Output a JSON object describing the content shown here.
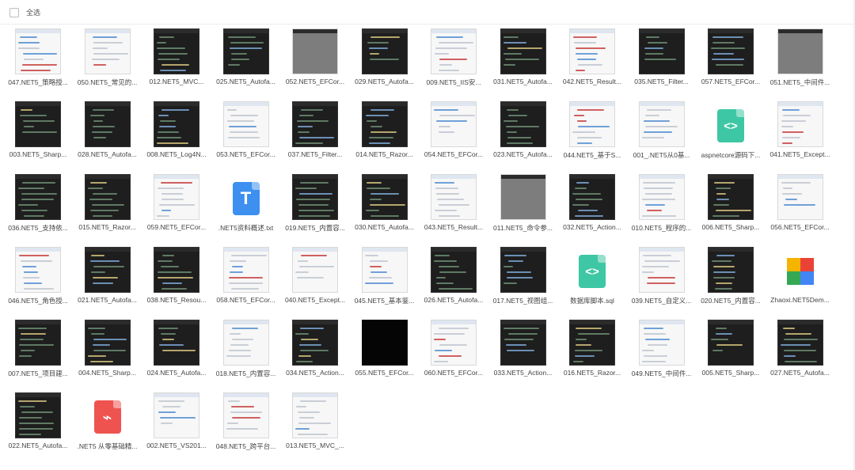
{
  "toolbar": {
    "select_all_label": "全选"
  },
  "files": [
    {
      "name": "047.NET5_策略授...",
      "kind": "image",
      "style": "light"
    },
    {
      "name": "050.NET5_常见的...",
      "kind": "image",
      "style": "light"
    },
    {
      "name": "012.NET5_MVC...",
      "kind": "image",
      "style": "dark"
    },
    {
      "name": "025.NET5_Autofa...",
      "kind": "image",
      "style": "dark"
    },
    {
      "name": "052.NET5_EFCor...",
      "kind": "image",
      "style": "gray"
    },
    {
      "name": "029.NET5_Autofa...",
      "kind": "image",
      "style": "dark"
    },
    {
      "name": "009.NET5_IIS安...",
      "kind": "image",
      "style": "light"
    },
    {
      "name": "031.NET5_Autofa...",
      "kind": "image",
      "style": "dark"
    },
    {
      "name": "042.NET5_Result...",
      "kind": "image",
      "style": "light"
    },
    {
      "name": "035.NET5_Filter...",
      "kind": "image",
      "style": "dark"
    },
    {
      "name": "057.NET5_EFCor...",
      "kind": "image",
      "style": "dark"
    },
    {
      "name": "051.NET5_中间件...",
      "kind": "image",
      "style": "gray"
    },
    {
      "name": "003.NET5_Sharp...",
      "kind": "image",
      "style": "dark"
    },
    {
      "name": "028.NET5_Autofa...",
      "kind": "image",
      "style": "dark"
    },
    {
      "name": "008.NET5_Log4N...",
      "kind": "image",
      "style": "dark"
    },
    {
      "name": "053.NET5_EFCor...",
      "kind": "image",
      "style": "light"
    },
    {
      "name": "037.NET5_Filter...",
      "kind": "image",
      "style": "dark"
    },
    {
      "name": "014.NET5_Razor...",
      "kind": "image",
      "style": "dark"
    },
    {
      "name": "054.NET5_EFCor...",
      "kind": "image",
      "style": "light"
    },
    {
      "name": "023.NET5_Autofa...",
      "kind": "image",
      "style": "dark"
    },
    {
      "name": "044.NET5_基于S...",
      "kind": "image",
      "style": "light"
    },
    {
      "name": "001_.NET5从0基...",
      "kind": "image",
      "style": "light"
    },
    {
      "name": "aspnetcore源码下...",
      "kind": "code"
    },
    {
      "name": "041.NET5_Except...",
      "kind": "image",
      "style": "light"
    },
    {
      "name": "036.NET5_支持依...",
      "kind": "image",
      "style": "dark"
    },
    {
      "name": "015.NET5_Razor...",
      "kind": "image",
      "style": "dark"
    },
    {
      "name": "059.NET5_EFCor...",
      "kind": "image",
      "style": "light"
    },
    {
      "name": ".NET5资料概述.txt",
      "kind": "txt"
    },
    {
      "name": "019.NET5_内置容...",
      "kind": "image",
      "style": "dark"
    },
    {
      "name": "030.NET5_Autofa...",
      "kind": "image",
      "style": "dark"
    },
    {
      "name": "043.NET5_Result...",
      "kind": "image",
      "style": "light"
    },
    {
      "name": "011.NET5_命令参...",
      "kind": "image",
      "style": "gray"
    },
    {
      "name": "032.NET5_Action...",
      "kind": "image",
      "style": "dark"
    },
    {
      "name": "010.NET5_程序的...",
      "kind": "image",
      "style": "light"
    },
    {
      "name": "006.NET5_Sharp...",
      "kind": "image",
      "style": "dark"
    },
    {
      "name": "056.NET5_EFCor...",
      "kind": "image",
      "style": "light"
    },
    {
      "name": "046.NET5_角色授...",
      "kind": "image",
      "style": "light"
    },
    {
      "name": "021.NET5_Autofa...",
      "kind": "image",
      "style": "dark"
    },
    {
      "name": "038.NET5_Resou...",
      "kind": "image",
      "style": "dark"
    },
    {
      "name": "058.NET5_EFCor...",
      "kind": "image",
      "style": "light"
    },
    {
      "name": "040.NET5_Except...",
      "kind": "image",
      "style": "light"
    },
    {
      "name": "045.NET5_基本鉴...",
      "kind": "image",
      "style": "light"
    },
    {
      "name": "026.NET5_Autofa...",
      "kind": "image",
      "style": "dark"
    },
    {
      "name": "017.NET5_视图组...",
      "kind": "image",
      "style": "dark"
    },
    {
      "name": "数据库脚本.sql",
      "kind": "code"
    },
    {
      "name": "039.NET5_自定义...",
      "kind": "image",
      "style": "light"
    },
    {
      "name": "020.NET5_内置容...",
      "kind": "image",
      "style": "dark"
    },
    {
      "name": "Zhaoxi.NET5Dem...",
      "kind": "zip"
    },
    {
      "name": "007.NET5_项目建...",
      "kind": "image",
      "style": "dark"
    },
    {
      "name": "004.NET5_Sharp...",
      "kind": "image",
      "style": "dark"
    },
    {
      "name": "024.NET5_Autofa...",
      "kind": "image",
      "style": "dark"
    },
    {
      "name": "018.NET5_内置容...",
      "kind": "image",
      "style": "light"
    },
    {
      "name": "034.NET5_Action...",
      "kind": "image",
      "style": "dark"
    },
    {
      "name": "055.NET5_EFCor...",
      "kind": "image",
      "style": "black"
    },
    {
      "name": "060.NET5_EFCor...",
      "kind": "image",
      "style": "light"
    },
    {
      "name": "033.NET5_Action...",
      "kind": "image",
      "style": "dark"
    },
    {
      "name": "016.NET5_Razor...",
      "kind": "image",
      "style": "dark"
    },
    {
      "name": "049.NET5_中间件...",
      "kind": "image",
      "style": "light"
    },
    {
      "name": "005.NET5_Sharp...",
      "kind": "image",
      "style": "dark"
    },
    {
      "name": "027.NET5_Autofa...",
      "kind": "image",
      "style": "dark"
    },
    {
      "name": "022.NET5_Autofa...",
      "kind": "image",
      "style": "dark"
    },
    {
      "name": ".NET5 从零基础精...",
      "kind": "pdf"
    },
    {
      "name": "002.NET5_VS201...",
      "kind": "image",
      "style": "light"
    },
    {
      "name": "048.NET5_跨平台...",
      "kind": "image",
      "style": "light"
    },
    {
      "name": "013.NET5_MVC_...",
      "kind": "image",
      "style": "light"
    }
  ]
}
